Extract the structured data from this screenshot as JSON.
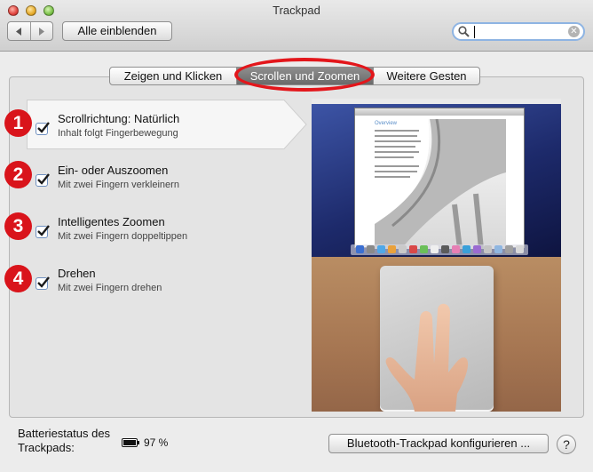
{
  "window": {
    "title": "Trackpad"
  },
  "toolbar": {
    "back_icon": "chevron-left-icon",
    "forward_icon": "chevron-right-icon",
    "show_all_label": "Alle einblenden",
    "search": {
      "value": "",
      "placeholder": ""
    }
  },
  "tabs": [
    {
      "label": "Zeigen und Klicken",
      "selected": false
    },
    {
      "label": "Scrollen und Zoomen",
      "selected": true
    },
    {
      "label": "Weitere Gesten",
      "selected": false
    }
  ],
  "options": [
    {
      "badge": "1",
      "title": "Scrollrichtung: Natürlich",
      "subtitle": "Inhalt folgt Fingerbewegung",
      "checked": true,
      "selected": true
    },
    {
      "badge": "2",
      "title": "Ein- oder Auszoomen",
      "subtitle": "Mit zwei Fingern verkleinern",
      "checked": true,
      "selected": false
    },
    {
      "badge": "3",
      "title": "Intelligentes Zoomen",
      "subtitle": "Mit zwei Fingern doppeltippen",
      "checked": true,
      "selected": false
    },
    {
      "badge": "4",
      "title": "Drehen",
      "subtitle": "Mit zwei Fingern drehen",
      "checked": true,
      "selected": false
    }
  ],
  "preview": {
    "doc_heading": "Overview"
  },
  "footer": {
    "battery_label": "Batteriestatus des Trackpads:",
    "battery_value": "97 %",
    "battery_level": 0.97,
    "configure_button": "Bluetooth-Trackpad konfigurieren ...",
    "help_label": "?"
  },
  "colors": {
    "annotation_red": "#e3161b",
    "selected_tab": "#7a7a7a",
    "checkbox_blue": "#2f6fcf"
  }
}
